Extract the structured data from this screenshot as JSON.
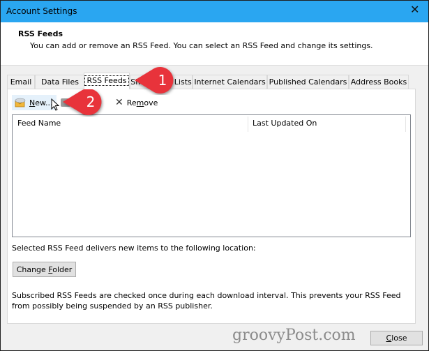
{
  "window": {
    "title": "Account Settings",
    "close_glyph": "✕"
  },
  "header": {
    "title": "RSS Feeds",
    "description": "You can add or remove an RSS Feed. You can select an RSS Feed and change its settings."
  },
  "tabs": [
    {
      "label": "Email",
      "active": false
    },
    {
      "label": "Data Files",
      "active": false
    },
    {
      "label": "RSS Feeds",
      "active": true
    },
    {
      "label": "SharePoint Lists",
      "active": false
    },
    {
      "label": "Internet Calendars",
      "active": false
    },
    {
      "label": "Published Calendars",
      "active": false
    },
    {
      "label": "Address Books",
      "active": false
    }
  ],
  "toolbar": {
    "new_label": "New...",
    "new_mnemonic": "N",
    "remove_label": "Remove",
    "remove_glyph": "✕"
  },
  "list": {
    "columns": [
      "Feed Name",
      "Last Updated On"
    ],
    "rows": []
  },
  "location_label": "Selected RSS Feed delivers new items to the following location:",
  "change_folder_label": "Change Folder",
  "note": "Subscribed RSS Feeds are checked once during each download interval. This prevents your RSS Feed from possibly being suspended by an RSS publisher.",
  "close_label": "Close",
  "watermark": "groovyPost.com",
  "callouts": [
    {
      "number": "1",
      "target": "RSS Feeds tab"
    },
    {
      "number": "2",
      "target": "New... button"
    }
  ],
  "colors": {
    "titlebar": "#2aa6f1",
    "callout": "#e8333b",
    "new_button_hover": "#e5f1fb"
  }
}
